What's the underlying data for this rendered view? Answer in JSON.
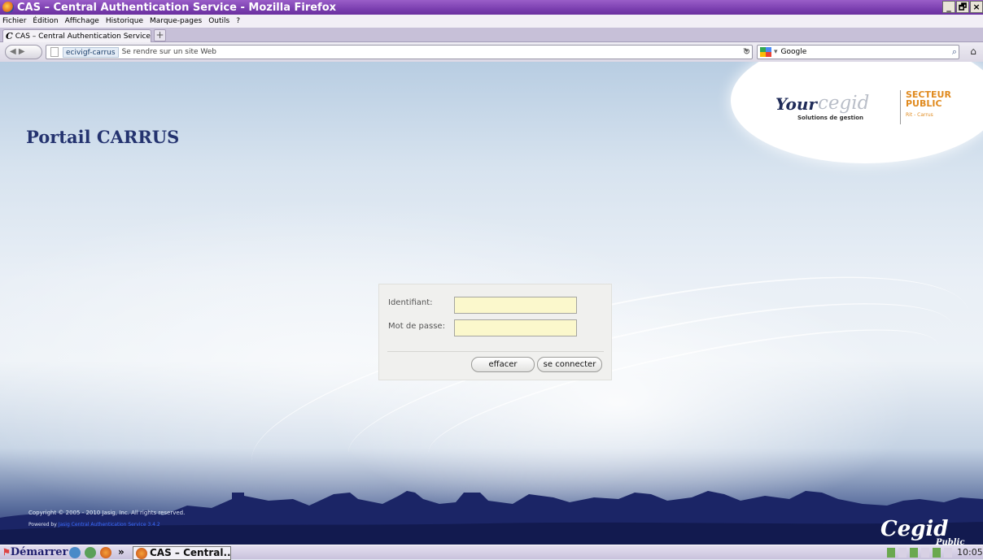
{
  "window": {
    "title": "CAS – Central Authentication Service - Mozilla Firefox",
    "controls": [
      "_",
      "🗗",
      "×"
    ]
  },
  "menubar": {
    "items": [
      "Fichier",
      "Édition",
      "Affichage",
      "Historique",
      "Marque-pages",
      "Outils",
      "?"
    ]
  },
  "tabs": {
    "active_label": "CAS – Central Authentication Service",
    "new_tab": "+"
  },
  "navbar": {
    "site_label": "ecivigf-carrus",
    "url_placeholder": "Se rendre sur un site Web",
    "search_placeholder": "Google"
  },
  "page": {
    "title": "Portail CARRUS",
    "logo": {
      "your": "Your",
      "cegid": "cegid",
      "subtitle": "Solutions de gestion",
      "sector": "SECTEUR",
      "public": "PUBLIC",
      "small": "Rit - Carrus"
    },
    "login": {
      "username_label": "Identifiant:",
      "password_label": "Mot de passe:",
      "username_value": "",
      "password_value": "",
      "clear_button": "effacer",
      "submit_button": "se connecter"
    },
    "footer": {
      "copyright": "Copyright © 2005 - 2010 Jasig, Inc. All rights reserved.",
      "powered_by": "Powered by",
      "powered_link": "Jasig Central Authentication Service 3.4.2"
    },
    "brand": {
      "cegid": "Cegid",
      "public": "Public"
    }
  },
  "taskbar": {
    "start": "Démarrer",
    "chevron": "»",
    "active_item": "CAS – Central...",
    "clock": "10:05"
  }
}
